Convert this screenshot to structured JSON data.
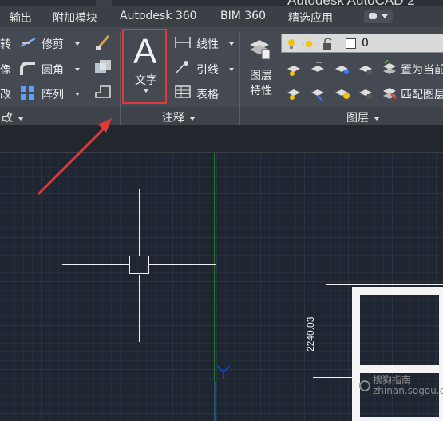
{
  "title_bar": {
    "app_title": "Autodesk AutoCAD 2"
  },
  "ribbon_tabs": [
    "输出",
    "附加模块",
    "Autodesk 360",
    "BIM 360",
    "精选应用"
  ],
  "modify_panel": {
    "title": "改",
    "tools": {
      "rotate": "转",
      "trim": "修剪",
      "mirror": "像",
      "fillet": "圆角",
      "stretch": "改",
      "array": "阵列"
    }
  },
  "annotation_panel": {
    "title": "注释",
    "text_button": {
      "glyph": "A",
      "label": "文字"
    },
    "linear": "线性",
    "leader": "引线",
    "table": "表格"
  },
  "layers_panel": {
    "title": "图层",
    "layer_properties": "图层\n特性",
    "current_layer": "0",
    "set_current": "置为当前",
    "match_layer": "匹配图层"
  },
  "drawing": {
    "dimension_text": "2240.03",
    "ucs_label": "Y"
  },
  "watermark": "搜狗指南\nzhinan.sogou.com",
  "colors": {
    "canvas_bg": "#1f2531",
    "ribbon_bg": "#454a52",
    "highlight": "#e23a3a",
    "arrow": "#e23a3a",
    "y_axis": "#1c3fbf",
    "green_axis": "#1f7a2a"
  }
}
